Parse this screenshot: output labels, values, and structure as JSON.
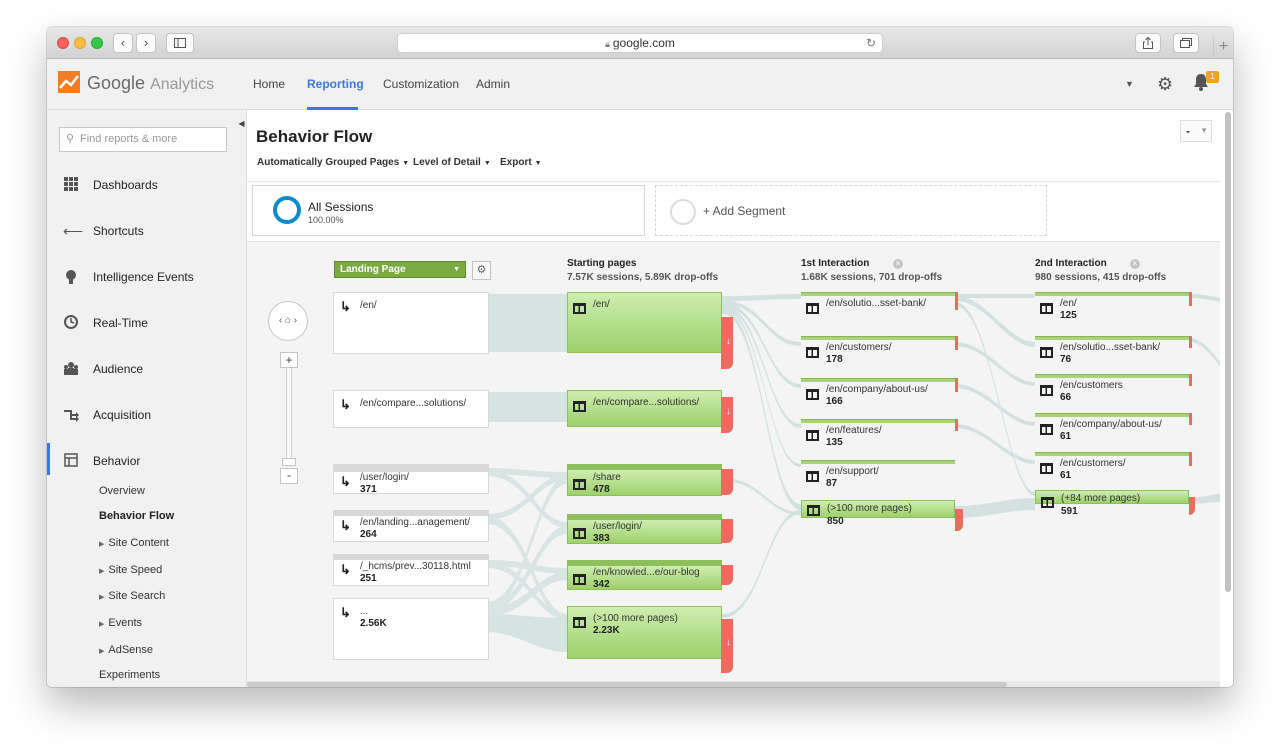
{
  "browser": {
    "url": "google.com",
    "nav_back": "‹",
    "nav_forward": "›"
  },
  "header": {
    "logo_google": "Google",
    "logo_analytics": "Analytics",
    "tabs": [
      "Home",
      "Reporting",
      "Customization",
      "Admin"
    ],
    "active_tab": "Reporting",
    "notification_count": "1"
  },
  "sidebar": {
    "search_placeholder": "Find reports & more",
    "items": [
      {
        "label": "Dashboards",
        "icon": "grid-icon"
      },
      {
        "label": "Shortcuts",
        "icon": "shortcut-arrow-icon"
      },
      {
        "label": "Intelligence Events",
        "icon": "lightbulb-icon"
      },
      {
        "label": "Real-Time",
        "icon": "clock-icon"
      },
      {
        "label": "Audience",
        "icon": "people-icon"
      },
      {
        "label": "Acquisition",
        "icon": "acquisition-icon"
      },
      {
        "label": "Behavior",
        "icon": "behavior-icon"
      }
    ],
    "behavior_sub": [
      "Overview",
      "Behavior Flow",
      "Site Content",
      "Site Speed",
      "Site Search",
      "Events",
      "AdSense",
      "Experiments"
    ],
    "active_sub": "Behavior Flow"
  },
  "page": {
    "title": "Behavior Flow",
    "title_select": "-",
    "toolbar": [
      "Automatically Grouped Pages",
      "Level of Detail",
      "Export"
    ]
  },
  "segments": {
    "all_name": "All Sessions",
    "all_pct": "100.00%",
    "add_label": "+ Add Segment"
  },
  "flow": {
    "dimension": "Landing Page",
    "columns": [
      {
        "title": "Starting pages",
        "sub": "7.57K sessions, 5.89K drop-offs"
      },
      {
        "title": "1st Interaction",
        "sub": "1.68K sessions, 701 drop-offs"
      },
      {
        "title": "2nd Interaction",
        "sub": "980 sessions, 415 drop-offs"
      }
    ],
    "landing": [
      {
        "label": "/en/",
        "value": ""
      },
      {
        "label": "/en/compare...solutions/",
        "value": ""
      },
      {
        "label": "/user/login/",
        "value": "371"
      },
      {
        "label": "/en/landing...anagement/",
        "value": "264"
      },
      {
        "label": "/_hcms/prev...30118.html",
        "value": "251"
      },
      {
        "label": "...",
        "value": "2.56K"
      }
    ],
    "starting": [
      {
        "label": "/en/",
        "value": ""
      },
      {
        "label": "/en/compare...solutions/",
        "value": ""
      },
      {
        "label": "/share",
        "value": "478"
      },
      {
        "label": "/user/login/",
        "value": "383"
      },
      {
        "label": "/en/knowled...e/our-blog",
        "value": "342"
      },
      {
        "label": "(>100 more pages)",
        "value": "2.23K"
      }
    ],
    "first": [
      {
        "label": "/en/solutio...sset-bank/",
        "value": ""
      },
      {
        "label": "/en/customers/",
        "value": "178"
      },
      {
        "label": "/en/company/about-us/",
        "value": "166"
      },
      {
        "label": "/en/features/",
        "value": "135"
      },
      {
        "label": "/en/support/",
        "value": "87"
      },
      {
        "label": "(>100 more pages)",
        "value": "850"
      }
    ],
    "second": [
      {
        "label": "/en/",
        "value": "125"
      },
      {
        "label": "/en/solutio...sset-bank/",
        "value": "76"
      },
      {
        "label": "/en/customers",
        "value": "66"
      },
      {
        "label": "/en/company/about-us/",
        "value": "61"
      },
      {
        "label": "/en/customers/",
        "value": "61"
      },
      {
        "label": "(+84 more pages)",
        "value": "591"
      }
    ]
  },
  "colors": {
    "accent": "#3b78e7",
    "node_green": "#9ed06a",
    "dropoff_red": "#ec6a5e",
    "segment_ring": "#0b8bc9"
  }
}
